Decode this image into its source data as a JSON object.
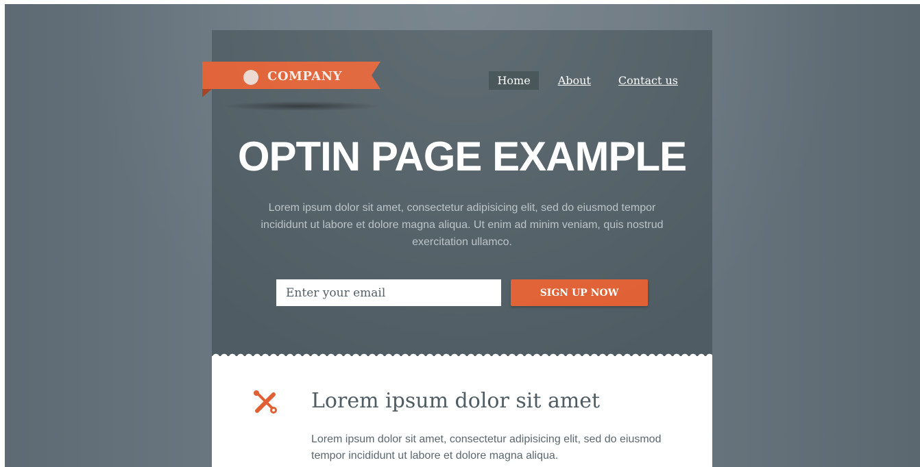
{
  "brand": {
    "name": "COMPANY",
    "accent_color": "#e05f33"
  },
  "nav": {
    "items": [
      "Home",
      "About",
      "Contact us"
    ],
    "active": "Home"
  },
  "hero": {
    "title": "OPTIN PAGE EXAMPLE",
    "text": "Lorem ipsum dolor sit amet, consectetur adipisicing elit, sed do eiusmod tempor incididunt ut labore et dolore magna aliqua. Ut enim ad minim veniam, quis nostrud exercitation ullamco."
  },
  "signup": {
    "email_placeholder": "Enter your email",
    "button_label": "SIGN UP NOW"
  },
  "feature": {
    "icon": "tools-icon",
    "title": "Lorem ipsum dolor sit amet",
    "text": "Lorem ipsum dolor sit amet, consectetur adipisicing elit, sed do eiusmod tempor incididunt ut labore et dolore magna aliqua."
  }
}
